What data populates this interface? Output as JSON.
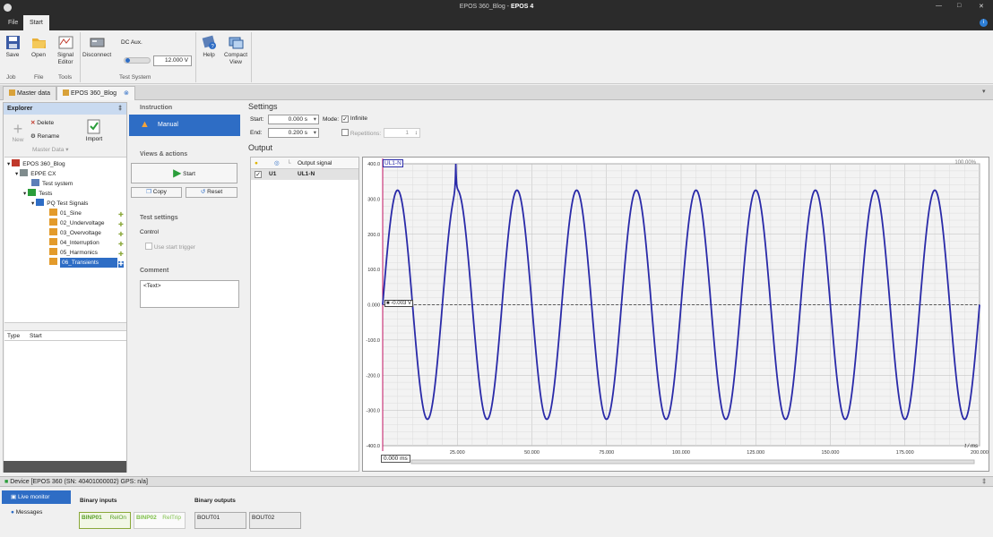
{
  "window": {
    "title_prefix": "EPOS 360_Blog - ",
    "title_app": "EPOS 4",
    "min": "—",
    "max": "□",
    "close": "✕"
  },
  "menu": {
    "file": "File",
    "start": "Start"
  },
  "ribbon": {
    "save": "Save",
    "open": "Open",
    "signal_editor": "Signal Editor",
    "disconnect": "Disconnect",
    "dc_aux": "DC Aux.",
    "dc_value": "12.000 V",
    "help": "Help",
    "compact_view": "Compact View",
    "groups": {
      "job": "Job",
      "file": "File",
      "tools": "Tools",
      "test_system": "Test System"
    }
  },
  "doc_tabs": {
    "master": "Master data",
    "blog": "EPOS 360_Blog"
  },
  "explorer": {
    "title": "Explorer",
    "pin": "‡",
    "new": "New",
    "delete": "Delete",
    "rename": "Rename",
    "master_data": "Master Data",
    "import": "Import",
    "tree": [
      "EPOS 360_Blog",
      "EPPE CX",
      "Test system",
      "Tests",
      "PQ Test Signals",
      "01_Sine",
      "02_Undervoltage",
      "03_Overvoltage",
      "04_Interruption",
      "05_Harmonics",
      "06_Transients"
    ],
    "table_cols": [
      "Type",
      "Start"
    ]
  },
  "instruction": {
    "title": "Instruction",
    "manual": "Manual",
    "views_title": "Views & actions",
    "start": "Start",
    "copy": "Copy",
    "reset": "Reset",
    "test_settings": "Test settings",
    "control": "Control",
    "use_start_trigger": "Use start trigger",
    "comment_title": "Comment",
    "comment_text": "<Text>"
  },
  "settings": {
    "title": "Settings",
    "start_label": "Start:",
    "start_value": "0.000 s",
    "end_label": "End:",
    "end_value": "0.200 s",
    "mode_label": "Mode:",
    "infinite": "Infinite",
    "repetitions": "Repetitions:",
    "rep_value": "1"
  },
  "output": {
    "title": "Output",
    "col_signal": "Output signal",
    "row_id": "U1",
    "row_signal": "UL1-N",
    "chart_zoom": "100.00%",
    "axis_unit": "t / ms",
    "cursor_value": "-0.003 V",
    "time_readout": "0.000 ms"
  },
  "chart_data": {
    "type": "line",
    "title": "UL1-N",
    "xlabel": "t / ms",
    "ylabel": "",
    "xlim": [
      0,
      200
    ],
    "ylim": [
      -400,
      400
    ],
    "x_ticks": [
      "25.000",
      "50.000",
      "75.000",
      "100.000",
      "125.000",
      "150.000",
      "175.000",
      "200.000"
    ],
    "y_ticks": [
      "400.0",
      "300.0",
      "200.0",
      "100.0",
      "0.000",
      "-100.0",
      "-200.0",
      "-300.0",
      "-400.0"
    ],
    "series": [
      {
        "name": "UL1-N",
        "amplitude": 325,
        "frequency_hz": 50,
        "transient": {
          "t_ms": 24.5,
          "peak": 400
        }
      }
    ],
    "color": "#2a2aa8"
  },
  "device": {
    "title": "Device [EPOS 360 (SN: 40401000002) GPS: n/a]",
    "live_monitor": "Live monitor",
    "messages": "Messages",
    "binary_inputs": "Binary inputs",
    "binary_outputs": "Binary outputs",
    "binp01": "BINP01",
    "binp01_state": "RelOn",
    "binp02": "BINP02",
    "binp02_state": "RelTrip",
    "bout01": "BOUT01",
    "bout02": "BOUT02"
  }
}
